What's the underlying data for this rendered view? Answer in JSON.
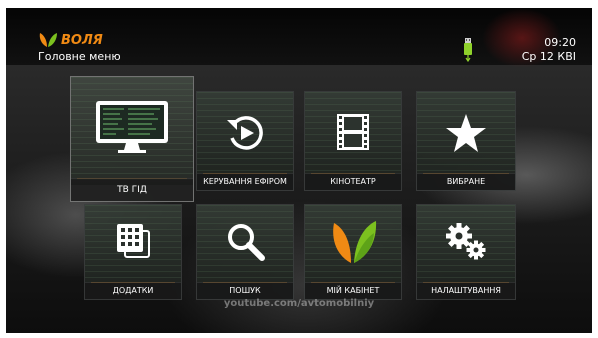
{
  "header": {
    "brand": "ВОЛЯ",
    "title": "Головне меню",
    "time": "09:20",
    "date": "Ср 12 КВІ",
    "colors": {
      "brand_orange": "#f08a14",
      "brand_green": "#7cc11f",
      "usb_green": "#8fd12b"
    }
  },
  "menu": [
    {
      "label": "ТВ ГІД",
      "icon": "tv-monitor-icon",
      "selected": true
    },
    {
      "label": "КЕРУВАННЯ ЕФІРОМ",
      "icon": "replay-icon",
      "selected": false
    },
    {
      "label": "КІНОТЕАТР",
      "icon": "film-strip-icon",
      "selected": false
    },
    {
      "label": "ВИБРАНЕ",
      "icon": "star-icon",
      "selected": false
    },
    {
      "label": "ДОДАТКИ",
      "icon": "apps-grid-icon",
      "selected": false
    },
    {
      "label": "ПОШУК",
      "icon": "search-icon",
      "selected": false
    },
    {
      "label": "МІЙ КАБІНЕТ",
      "icon": "volia-logo-icon",
      "selected": false
    },
    {
      "label": "НАЛАШТУВАННЯ",
      "icon": "gears-icon",
      "selected": false
    }
  ],
  "watermark": "youtube.com/avtomobilniy"
}
